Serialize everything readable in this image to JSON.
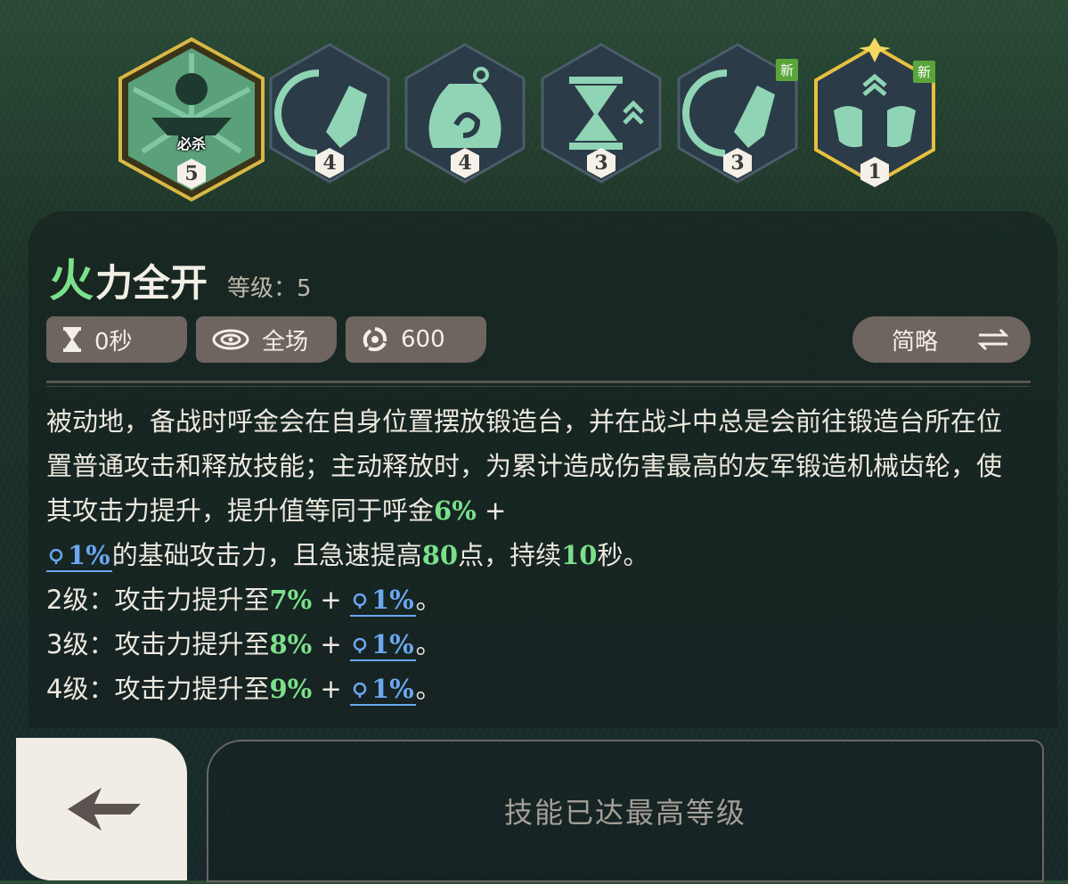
{
  "skills": [
    {
      "name": "forge-anvil",
      "level": "5",
      "tag": "必杀",
      "selected": true,
      "is_new": false
    },
    {
      "name": "blade-swipe",
      "level": "4",
      "is_new": false
    },
    {
      "name": "gear-pouch",
      "level": "4",
      "is_new": false
    },
    {
      "name": "haste-hourglass",
      "level": "3",
      "is_new": false
    },
    {
      "name": "blade-swipe-2",
      "level": "3",
      "is_new": true
    },
    {
      "name": "twin-tools",
      "level": "1",
      "is_new": true
    }
  ],
  "new_label": "新",
  "detail": {
    "title_first": "火",
    "title_rest": "力全开",
    "level_label": "等级：5",
    "stats": {
      "cooldown": "0秒",
      "range": "全场",
      "energy": "600"
    },
    "toggle_label": "简略",
    "desc": {
      "p1_a": "被动地，备战时呼金会在自身位置摆放锻造台，并在战斗中总是会前往锻造台所在位置普通攻击和释放技能；主动释放时，为累计造成伤害最高的友军锻造机械齿轮，使其攻击力提升，提升值等同于呼金",
      "p1_g1": "6%",
      "p1_plus": " + ",
      "p1_b1": "1%",
      "p1_b": "的基础攻击力，且急速提高",
      "p1_g2": "80",
      "p1_c": "点，持续",
      "p1_g3": "10",
      "p1_d": "秒。",
      "l2_a": "2级：攻击力提升至",
      "l2_g": "7%",
      "l2_plus": " + ",
      "l2_b": "1%",
      "l2_end": "。",
      "l3_a": "3级：攻击力提升至",
      "l3_g": "8%",
      "l3_plus": " + ",
      "l3_b": "1%",
      "l3_end": "。",
      "l4_a": "4级：攻击力提升至",
      "l4_g": "9%",
      "l4_plus": " + ",
      "l4_b": "1%",
      "l4_end": "。"
    }
  },
  "max_level_text": "技能已达最高等级",
  "colors": {
    "accent_green": "#7be08a",
    "scaling_blue": "#6aa8f0",
    "gold": "#e8c040"
  }
}
